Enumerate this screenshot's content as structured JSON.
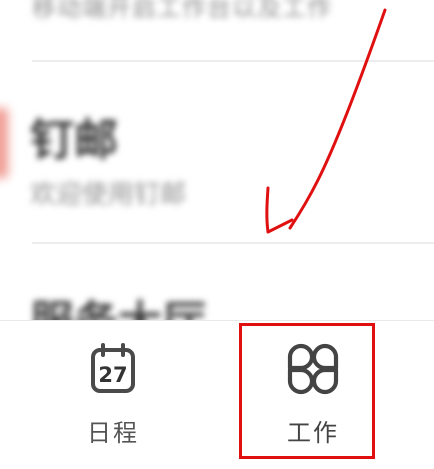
{
  "list": {
    "previous_item_subtitle": "移动端开启工作台以及工作",
    "current_item": {
      "title": "钉邮",
      "subtitle": "欢迎使用钉邮"
    },
    "next_item_title": "服务大厅"
  },
  "tabbar": {
    "tabs": [
      {
        "id": "calendar",
        "label": "日程",
        "icon": "calendar-icon",
        "date_number": "27",
        "selected": false
      },
      {
        "id": "work",
        "label": "工作",
        "icon": "workbench-grid-icon",
        "selected": false
      }
    ]
  },
  "annotation": {
    "color": "#e01010",
    "target": "tab-work"
  }
}
